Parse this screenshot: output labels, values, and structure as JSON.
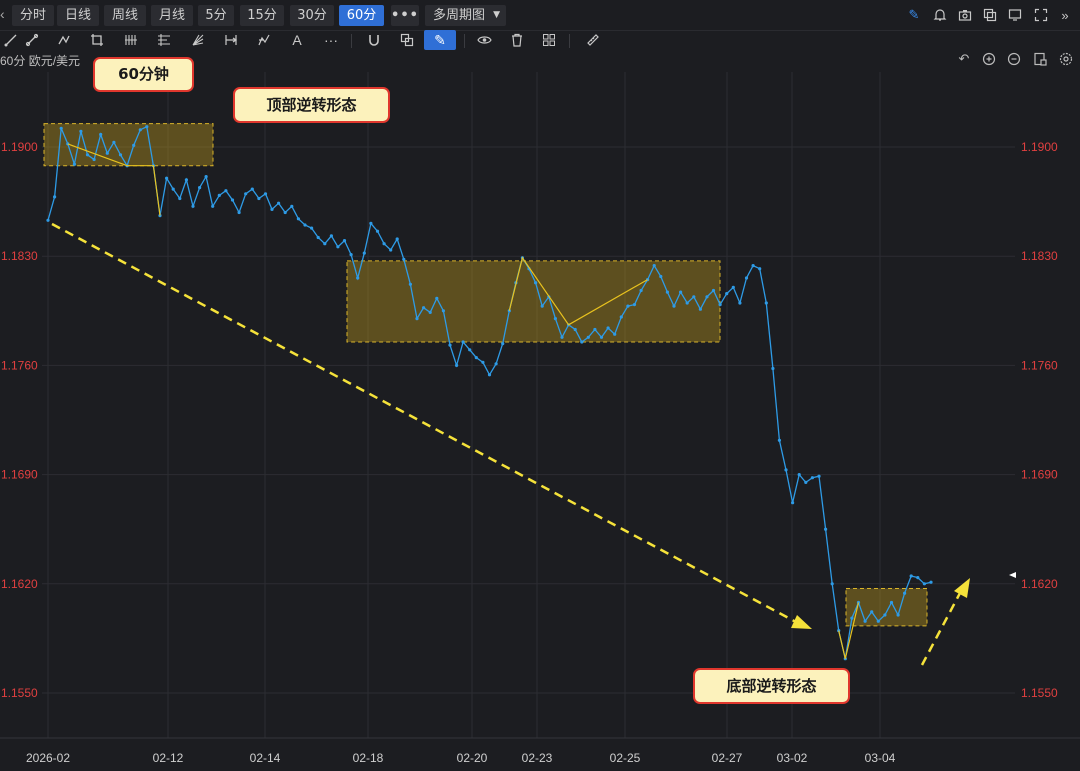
{
  "tabs": [
    {
      "label": "分时",
      "active": false
    },
    {
      "label": "日线",
      "active": false
    },
    {
      "label": "周线",
      "active": false
    },
    {
      "label": "月线",
      "active": false
    },
    {
      "label": "5分",
      "active": false
    },
    {
      "label": "15分",
      "active": false
    },
    {
      "label": "30分",
      "active": false
    },
    {
      "label": "60分",
      "active": true
    }
  ],
  "more_label": "•••",
  "multi_period_label": "多周期图",
  "symbol": {
    "period": "60分",
    "name": "欧元/美元"
  },
  "annotations": {
    "timeframe": "60分钟",
    "top_reversal": "顶部逆转形态",
    "bottom_reversal": "底部逆转形态"
  },
  "icons": {
    "top_right": [
      "pen-icon",
      "bell-icon",
      "camera-icon",
      "copy-icon",
      "monitor-icon",
      "fullscreen-icon",
      "collapse-icon"
    ],
    "toolbar": [
      "line-tool-icon",
      "ray-tool-icon",
      "polyline-tool-icon",
      "crop-tool-icon",
      "pitchfork-tool-icon",
      "fibonacci-tool-icon",
      "fan-tool-icon",
      "range-tool-icon",
      "wave-tool-icon",
      "text-tool-icon",
      "more-tools-icon",
      "magnet-icon",
      "layer-icon",
      "draw-pen-icon",
      "eye-icon",
      "trash-icon",
      "layout-icon",
      "ruler-icon"
    ],
    "chart_controls": [
      "undo-icon",
      "zoom-in-icon",
      "zoom-out-icon",
      "object-settings-icon",
      "settings-icon"
    ]
  },
  "colors": {
    "background": "#1c1d21",
    "price_line": "#2e9be6",
    "y_tick_label": "#e04040",
    "highlight_box": "#d9b42a",
    "trend_arrow": "#f5e23a",
    "accent_tab": "#2f6fd6"
  },
  "chart_data": {
    "type": "line",
    "series_name": "EUR/USD 60min",
    "x_labels": [
      "2026-02",
      "02-12",
      "02-14",
      "02-18",
      "02-20",
      "02-23",
      "02-25",
      "02-27",
      "03-02",
      "03-04"
    ],
    "y_ticks": [
      "1.1900",
      "1.1830",
      "1.1760",
      "1.1690",
      "1.1620",
      "1.1550"
    ],
    "ylim": [
      1.1525,
      1.1945
    ],
    "last_price": 1.1621,
    "values": [
      1.1853,
      1.1868,
      1.1912,
      1.1902,
      1.1889,
      1.191,
      1.1895,
      1.1892,
      1.1908,
      1.1896,
      1.1903,
      1.1895,
      1.1888,
      1.1901,
      1.1911,
      1.1913,
      1.1888,
      1.1856,
      1.188,
      1.1873,
      1.1867,
      1.1879,
      1.1862,
      1.1874,
      1.1881,
      1.1862,
      1.1869,
      1.1872,
      1.1866,
      1.1858,
      1.187,
      1.1873,
      1.1867,
      1.187,
      1.186,
      1.1864,
      1.1858,
      1.1862,
      1.1854,
      1.185,
      1.1848,
      1.1842,
      1.1838,
      1.1843,
      1.1836,
      1.184,
      1.1831,
      1.1816,
      1.1832,
      1.1851,
      1.1846,
      1.1838,
      1.1834,
      1.1841,
      1.1828,
      1.1812,
      1.179,
      1.1797,
      1.1794,
      1.1803,
      1.1795,
      1.1773,
      1.176,
      1.1775,
      1.177,
      1.1765,
      1.1762,
      1.1754,
      1.1761,
      1.1774,
      1.1795,
      1.1813,
      1.1829,
      1.1822,
      1.1813,
      1.1798,
      1.1804,
      1.179,
      1.1778,
      1.1786,
      1.1783,
      1.1775,
      1.1778,
      1.1783,
      1.1778,
      1.1784,
      1.178,
      1.1791,
      1.1798,
      1.1799,
      1.1808,
      1.1815,
      1.1824,
      1.1817,
      1.1807,
      1.1798,
      1.1807,
      1.18,
      1.1804,
      1.1796,
      1.1804,
      1.1808,
      1.1799,
      1.1806,
      1.181,
      1.18,
      1.1816,
      1.1824,
      1.1822,
      1.18,
      1.1758,
      1.1712,
      1.1693,
      1.1672,
      1.169,
      1.1685,
      1.1688,
      1.1689,
      1.1655,
      1.162,
      1.159,
      1.1572,
      1.1598,
      1.1608,
      1.1596,
      1.1602,
      1.1596,
      1.16,
      1.1608,
      1.16,
      1.1614,
      1.1625,
      1.1624,
      1.162,
      1.1621
    ],
    "patterns": [
      {
        "name": "top",
        "range": [
          1.1888,
          1.1915
        ]
      },
      {
        "name": "middle",
        "range": [
          1.1775,
          1.1827
        ]
      },
      {
        "name": "bottom",
        "range": [
          1.1593,
          1.1617
        ]
      }
    ]
  }
}
